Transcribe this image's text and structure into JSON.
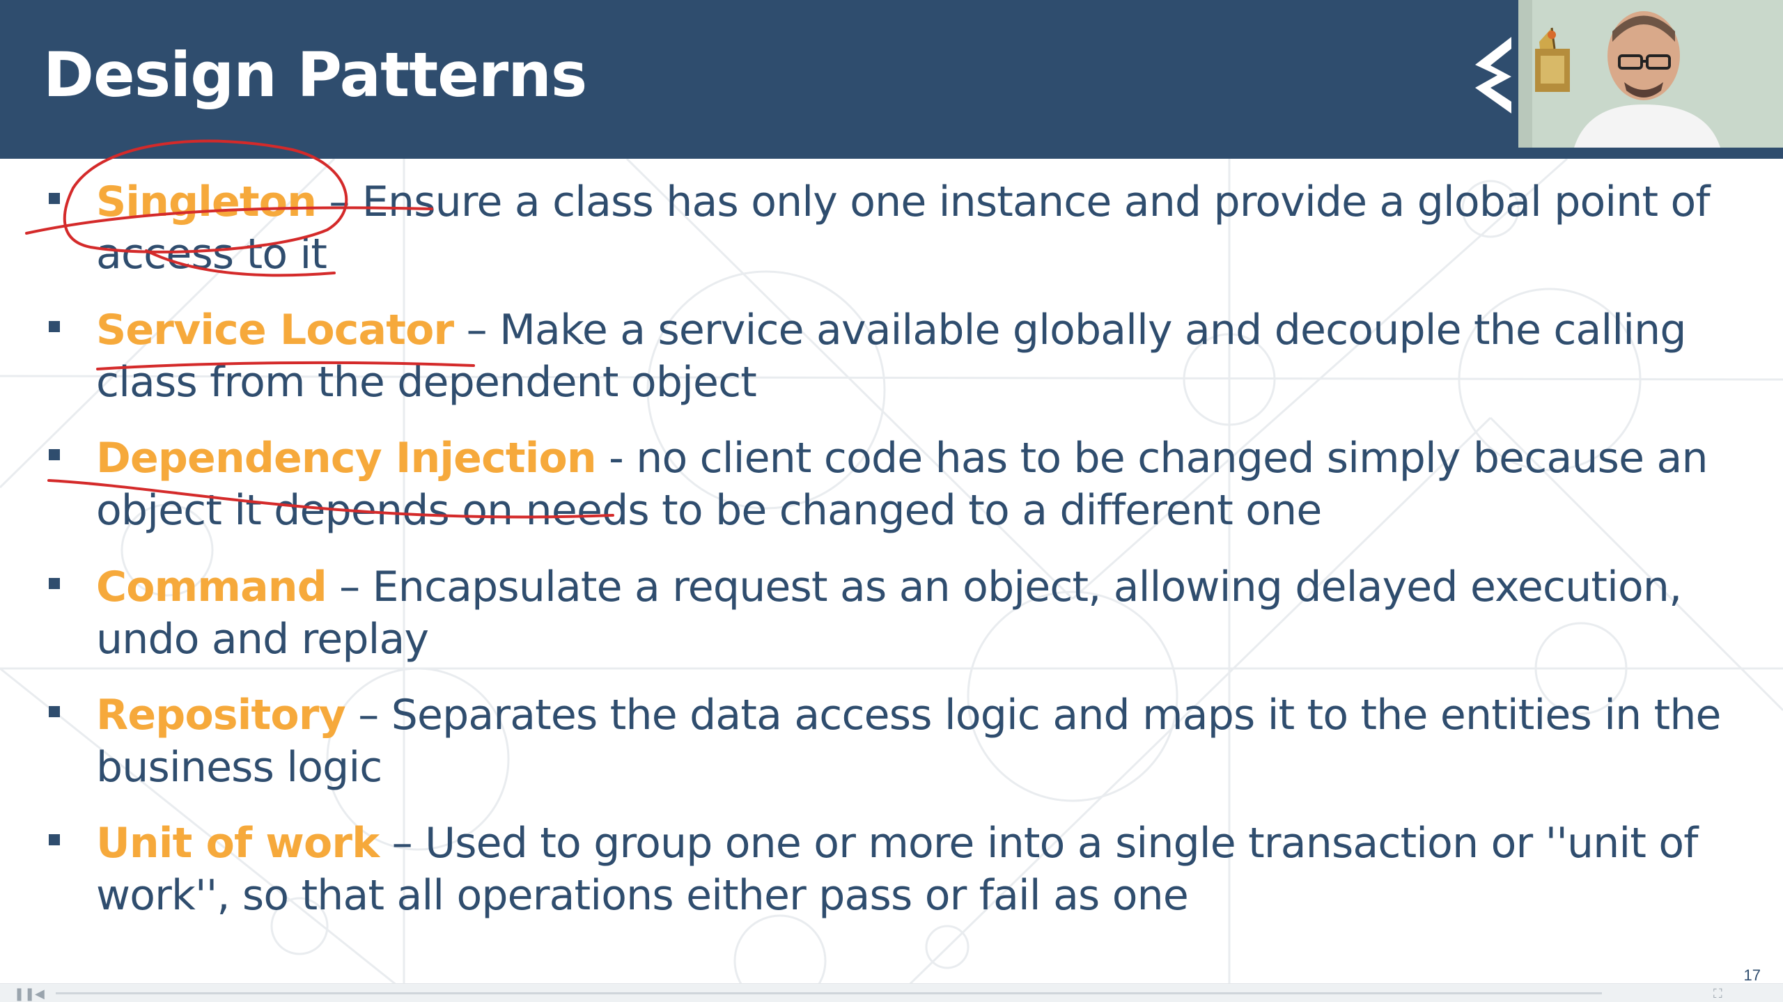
{
  "slide": {
    "title": "Design Patterns",
    "page_number": "17",
    "colors": {
      "header": "#2f4d6e",
      "text": "#2f4d6e",
      "term": "#f6a93b",
      "annotation_ink": "#d42a2a"
    }
  },
  "logo": {
    "icon": "company-logo-icon"
  },
  "webcam": {
    "icon": "presenter-video-icon"
  },
  "bullets": [
    {
      "term": "Singleton",
      "description": " – Ensure a class has only one instance and provide a global point of access to it"
    },
    {
      "term": "Service Locator",
      "description": " – Make a service available globally and decouple the calling class from the dependent object"
    },
    {
      "term": "Dependency Injection",
      "description": " - no client code has to be changed simply because an object it depends on needs to be changed to a different one"
    },
    {
      "term": "Command",
      "description": " – Encapsulate a request as an object, allowing delayed execution, undo and replay"
    },
    {
      "term": "Repository",
      "description": " – Separates the data access logic and maps it to the entities in the business logic"
    },
    {
      "term": "Unit of work",
      "description": " – Used to group one or more into a single transaction or ''unit of work'', so that all operations either pass or fail as one"
    }
  ],
  "player": {
    "play_icon": "play-icon",
    "volume_icon": "volume-icon",
    "fullscreen_icon": "fullscreen-icon"
  }
}
